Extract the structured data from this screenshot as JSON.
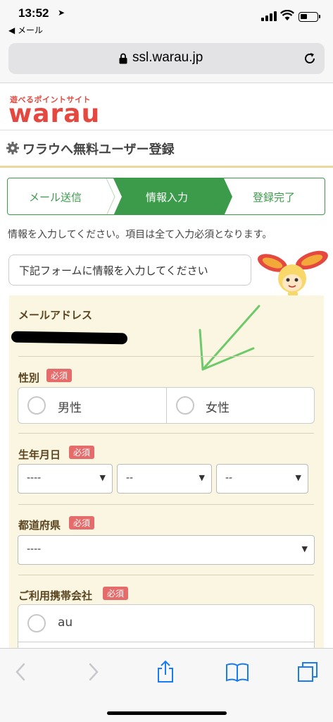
{
  "status_bar": {
    "time": "13:52",
    "back_app": "◀ メール"
  },
  "browser": {
    "url": "ssl.warau.jp"
  },
  "site": {
    "tagline": "遊べるポイントサイト",
    "logo": "warau"
  },
  "page_title": "ワラウへ無料ユーザー登録",
  "steps": [
    "メール送信",
    "情報入力",
    "登録完了"
  ],
  "instruction": "情報を入力してください。項目は全て入力必須となります。",
  "callout": "下記フォームに情報を入力してください",
  "form": {
    "email": {
      "label": "メールアドレス"
    },
    "gender": {
      "label": "性別",
      "required": "必須",
      "options": [
        "男性",
        "女性"
      ]
    },
    "birthdate": {
      "label": "生年月日",
      "required": "必須",
      "year": "----",
      "month": "--",
      "day": "--"
    },
    "prefecture": {
      "label": "都道府県",
      "required": "必須",
      "value": "----"
    },
    "carrier": {
      "label": "ご利用携帯会社",
      "required": "必須",
      "options": [
        "au"
      ]
    }
  },
  "colors": {
    "brand": "#e5483f",
    "step_active": "#3b9b4a",
    "form_bg": "#fbf6e1",
    "required": "#e66b6b",
    "ios_blue": "#1a7cf5"
  }
}
